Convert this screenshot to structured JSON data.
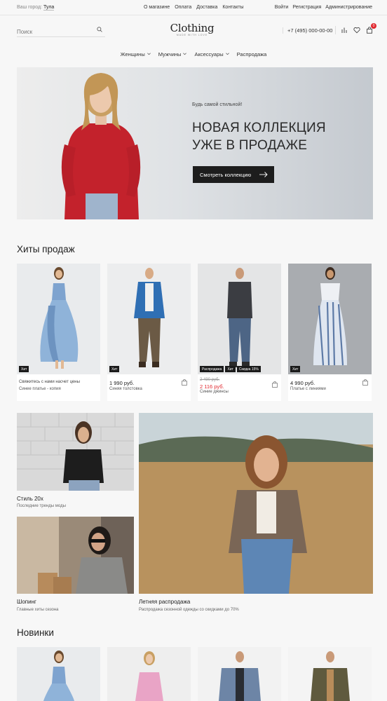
{
  "topbar": {
    "city_label": "Ваш город:",
    "city_value": "Тула",
    "nav": [
      "О магазине",
      "Оплата",
      "Доставка",
      "Контакты"
    ],
    "auth": [
      "Войти",
      "Регистрация",
      "Администрирование"
    ]
  },
  "header": {
    "search_placeholder": "Поиск",
    "logo_name": "Clothing",
    "logo_tagline": "MADE WITH LOVE",
    "phone": "+7 (495) 000-00-00",
    "cart_count": "0",
    "colors": {
      "badge": "#e0282f",
      "button": "#1d1d1d"
    }
  },
  "mainnav": [
    "Женщины",
    "Мужчины",
    "Аксессуары",
    "Распродажа"
  ],
  "hero": {
    "subtitle": "Будь самой стильной!",
    "title_line1": "НОВАЯ КОЛЛЕКЦИЯ",
    "title_line2": "УЖЕ В ПРОДАЖЕ",
    "button_label": "Смотреть коллекцию"
  },
  "bestsellers": {
    "title": "Хиты продаж",
    "items": [
      {
        "tags": [
          "Хит"
        ],
        "promo": "Свяжитесь с нами насчет цены",
        "name": "Синее платье - копия"
      },
      {
        "tags": [
          "Хит"
        ],
        "price": "1 990 руб.",
        "name": "Синяя толстовка"
      },
      {
        "tags": [
          "Распродажа",
          "Хит",
          "Скидка 15%"
        ],
        "old_price": "2 490 руб.",
        "new_price": "2 116 руб.",
        "name": "Синие джинсы"
      },
      {
        "tags": [
          "Хит"
        ],
        "price": "4 990 руб.",
        "name": "Платье с линиями"
      }
    ]
  },
  "promos": [
    {
      "title": "Стиль 20х",
      "subtitle": "Последние тренды моды"
    },
    {
      "title": "Шопинг",
      "subtitle": "Главные хиты сезона"
    },
    {
      "title": "Летняя распродажа",
      "subtitle": "Распродажа сезонной одежды со скидками до 70%"
    }
  ],
  "novelties": {
    "title": "Новинки"
  }
}
